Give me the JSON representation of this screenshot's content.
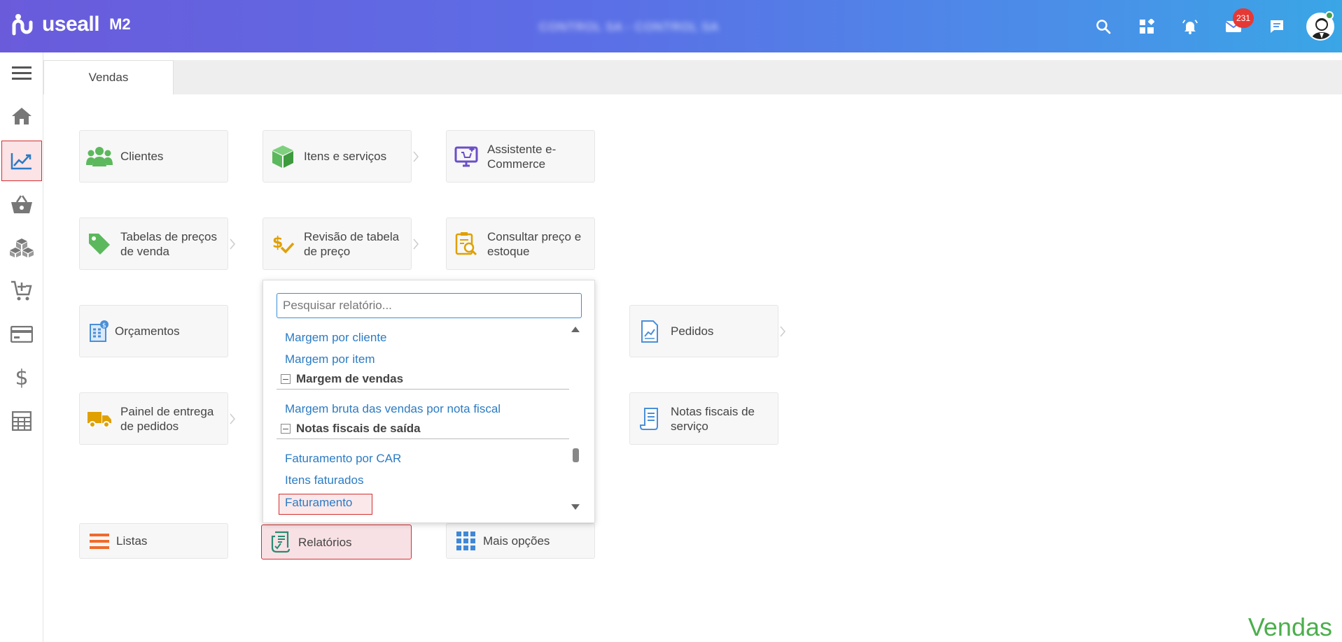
{
  "header": {
    "brand": "useall",
    "version": "M2",
    "company_blurred": "CONTROL SA - CONTROL SA",
    "notification_count": "231",
    "icons": [
      "search-icon",
      "apps-grid-icon",
      "bell-icon",
      "mail-icon",
      "chat-icon",
      "user-avatar"
    ]
  },
  "sidebar": {
    "items": [
      "menu-icon",
      "home-icon",
      "sales-chart-icon",
      "basket-icon",
      "boxes-icon",
      "cart-add-icon",
      "card-icon",
      "dollar-icon",
      "calculator-icon"
    ],
    "active": "sales-chart-icon"
  },
  "tabs": [
    {
      "label": "Vendas"
    }
  ],
  "tiles": {
    "clientes": "Clientes",
    "itens": "Itens e serviços",
    "assistente": "Assistente e-Commerce",
    "tabelas": "Tabelas de preços de venda",
    "revisao": "Revisão de tabela de preço",
    "consultar": "Consultar preço e estoque",
    "orcamentos": "Orçamentos",
    "pedidos": "Pedidos",
    "painel": "Painel de entrega de pedidos",
    "notas_servico": "Notas fiscais de serviço",
    "listas": "Listas",
    "relatorios": "Relatórios",
    "mais": "Mais opções"
  },
  "report_dropdown": {
    "search_placeholder": "Pesquisar relatório...",
    "items": {
      "margem_cliente": "Margem por cliente",
      "margem_item": "Margem por item",
      "group_margem": "Margem de vendas",
      "margem_bruta": "Margem bruta das vendas por nota fiscal",
      "group_notas": "Notas fiscais de saída",
      "fat_car": "Faturamento por CAR",
      "itens_faturados": "Itens faturados",
      "faturamento": "Faturamento"
    },
    "selected": "Faturamento"
  },
  "module_title": "Vendas",
  "colors": {
    "accent": "#2b7bc4",
    "highlight": "#d32f2f",
    "module_green": "#4cae4c"
  }
}
